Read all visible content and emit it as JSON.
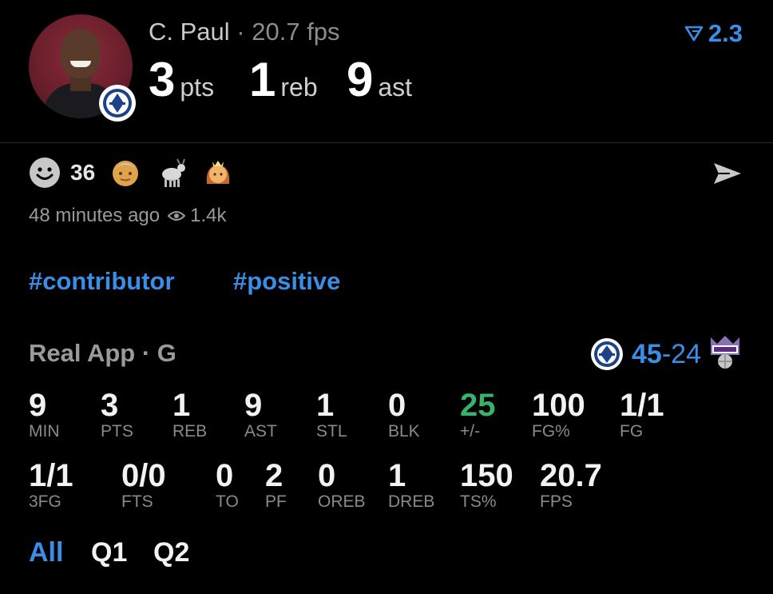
{
  "header": {
    "player_name": "C. Paul",
    "separator": "·",
    "fps_label": "20.7 fps",
    "line_value": "2.3",
    "stats": [
      {
        "value": "3",
        "unit": "pts"
      },
      {
        "value": "1",
        "unit": "reb"
      },
      {
        "value": "9",
        "unit": "ast"
      }
    ]
  },
  "reactions": {
    "count": "36",
    "emojis": [
      "old-man-emoji",
      "goat-emoji",
      "princess-emoji"
    ]
  },
  "meta": {
    "time_ago": "48 minutes ago",
    "views": "1.4k"
  },
  "tags": [
    "#contributor",
    "#positive"
  ],
  "game": {
    "source": "Real App · G",
    "score_home": "45",
    "score_dash": "-",
    "score_away": "24"
  },
  "stats_row1": [
    {
      "value": "9",
      "label": "MIN"
    },
    {
      "value": "3",
      "label": "PTS"
    },
    {
      "value": "1",
      "label": "REB"
    },
    {
      "value": "9",
      "label": "AST"
    },
    {
      "value": "1",
      "label": "STL"
    },
    {
      "value": "0",
      "label": "BLK"
    },
    {
      "value": "25",
      "label": "+/-"
    },
    {
      "value": "100",
      "label": "FG%"
    },
    {
      "value": "1/1",
      "label": "FG"
    }
  ],
  "stats_row2": [
    {
      "value": "1/1",
      "label": "3FG"
    },
    {
      "value": "0/0",
      "label": "FTS"
    },
    {
      "value": "0",
      "label": "TO"
    },
    {
      "value": "2",
      "label": "PF"
    },
    {
      "value": "0",
      "label": "OREB"
    },
    {
      "value": "1",
      "label": "DREB"
    },
    {
      "value": "150",
      "label": "TS%"
    },
    {
      "value": "20.7",
      "label": "FPS"
    }
  ],
  "periods": {
    "all": "All",
    "q1": "Q1",
    "q2": "Q2",
    "active": "All"
  },
  "colors": {
    "accent": "#3a8ee6",
    "positive": "#39b36b"
  }
}
